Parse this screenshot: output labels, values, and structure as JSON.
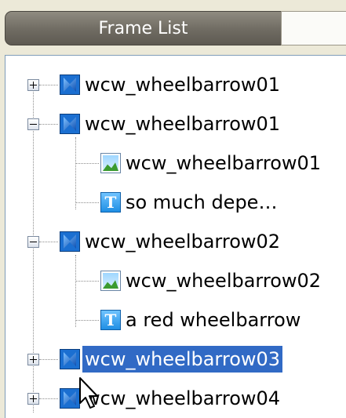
{
  "panel": {
    "tabs": [
      {
        "label": "Frame List",
        "active": true
      },
      {
        "label": "",
        "active": false
      }
    ]
  },
  "tree": {
    "rows": [
      {
        "label": "wcw_wheelbarrow01",
        "icon": "video-clip-icon",
        "expander": "plus",
        "level": 0
      },
      {
        "label": "wcw_wheelbarrow01",
        "icon": "video-clip-icon",
        "expander": "minus",
        "level": 0
      },
      {
        "label": "wcw_wheelbarrow01",
        "icon": "image-icon",
        "level": 1
      },
      {
        "label": "so much depe…",
        "icon": "text-icon",
        "level": 1
      },
      {
        "label": "wcw_wheelbarrow02",
        "icon": "video-clip-icon",
        "expander": "minus",
        "level": 0
      },
      {
        "label": "wcw_wheelbarrow02",
        "icon": "image-icon",
        "level": 1
      },
      {
        "label": "a red wheelbarrow",
        "icon": "text-icon",
        "level": 1
      },
      {
        "label": "wcw_wheelbarrow03",
        "icon": "video-clip-icon",
        "expander": "plus",
        "level": 0,
        "selected": true
      },
      {
        "label": "wcw_wheelbarrow04",
        "icon": "video-clip-icon",
        "expander": "plus",
        "level": 0
      }
    ],
    "text_icon_glyph": "T",
    "selection_color": "#316ac5"
  }
}
